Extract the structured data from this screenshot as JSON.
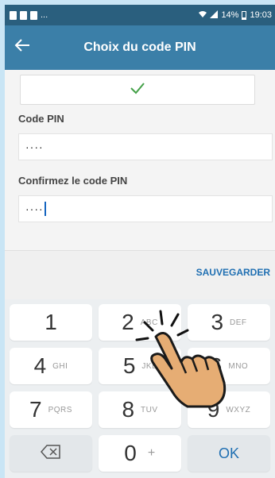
{
  "status_bar": {
    "left_text": "...",
    "battery": "14%",
    "time": "19:03"
  },
  "app_bar": {
    "title": "Choix du code PIN",
    "back_icon": "arrow-left-icon"
  },
  "form": {
    "success_icon": "checkmark-icon",
    "pin_label": "Code PIN",
    "pin_value": "····",
    "confirm_label": "Confirmez le code PIN",
    "confirm_value": "····"
  },
  "actions": {
    "save_label": "SAUVEGARDER"
  },
  "keypad": {
    "keys": [
      {
        "num": "1",
        "letters": ""
      },
      {
        "num": "2",
        "letters": "ABC"
      },
      {
        "num": "3",
        "letters": "DEF"
      },
      {
        "num": "4",
        "letters": "GHI"
      },
      {
        "num": "5",
        "letters": "JKL"
      },
      {
        "num": "6",
        "letters": "MNO"
      },
      {
        "num": "7",
        "letters": "PQRS"
      },
      {
        "num": "8",
        "letters": "TUV"
      },
      {
        "num": "9",
        "letters": "WXYZ"
      },
      {
        "num": "0",
        "letters": "+"
      }
    ],
    "backspace_icon": "backspace-icon",
    "ok_label": "OK"
  },
  "overlay": {
    "hand_icon": "tapping-hand-icon"
  },
  "colors": {
    "accent": "#3b7fa8",
    "status_bar": "#2a5f7e",
    "check": "#43a047",
    "link": "#1f6fb2"
  }
}
